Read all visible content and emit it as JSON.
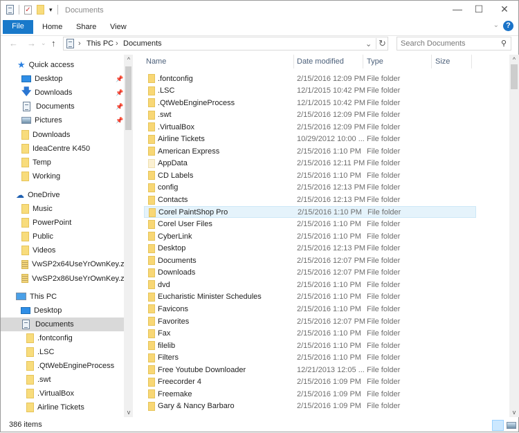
{
  "window": {
    "title": "Documents",
    "minimize": "—",
    "maximize": "☐",
    "close": "✕"
  },
  "ribbon": {
    "file": "File",
    "tabs": [
      "Home",
      "Share",
      "View"
    ],
    "help": "?",
    "collapse": "⌄"
  },
  "address": {
    "back": "←",
    "forward": "→",
    "recent": "⌄",
    "up": "↑",
    "crumbs": [
      "This PC",
      "Documents"
    ],
    "sep": "›",
    "dropdown": "⌄",
    "refresh": "↻"
  },
  "search": {
    "placeholder": "Search Documents",
    "icon": "⚲"
  },
  "nav": {
    "quick_access": "Quick access",
    "quick_items": [
      {
        "label": "Desktop",
        "icon": "desktop-icon",
        "pinned": true
      },
      {
        "label": "Downloads",
        "icon": "downloads-icon",
        "pinned": true
      },
      {
        "label": "Documents",
        "icon": "documents-icon",
        "pinned": true
      },
      {
        "label": "Pictures",
        "icon": "pictures-icon",
        "pinned": true
      },
      {
        "label": "Downloads",
        "icon": "folder-icon"
      },
      {
        "label": "IdeaCentre K450",
        "icon": "folder-icon"
      },
      {
        "label": "Temp",
        "icon": "folder-icon"
      },
      {
        "label": "Working",
        "icon": "folder-icon"
      }
    ],
    "onedrive": "OneDrive",
    "onedrive_items": [
      {
        "label": "Music",
        "icon": "folder-icon"
      },
      {
        "label": "PowerPoint",
        "icon": "folder-icon"
      },
      {
        "label": "Public",
        "icon": "folder-icon"
      },
      {
        "label": "Videos",
        "icon": "folder-icon"
      },
      {
        "label": "VwSP2x64UseYrOwnKey.zip",
        "icon": "zip-icon"
      },
      {
        "label": "VwSP2x86UseYrOwnKey.zip",
        "icon": "zip-icon"
      }
    ],
    "this_pc": "This PC",
    "this_pc_items": [
      {
        "label": "Desktop",
        "icon": "desktop-icon"
      },
      {
        "label": "Documents",
        "icon": "documents-icon",
        "selected": true
      }
    ],
    "documents_children": [
      ".fontconfig",
      ".LSC",
      ".QtWebEngineProcess",
      ".swt",
      ".VirtualBox",
      "Airline Tickets"
    ]
  },
  "columns": {
    "name": "Name",
    "date": "Date modified",
    "type": "Type",
    "size": "Size"
  },
  "files": [
    [
      ".fontconfig",
      "2/15/2016 12:09 PM",
      "File folder"
    ],
    [
      ".LSC",
      "12/1/2015 10:42 PM",
      "File folder"
    ],
    [
      ".QtWebEngineProcess",
      "12/1/2015 10:42 PM",
      "File folder"
    ],
    [
      ".swt",
      "2/15/2016 12:09 PM",
      "File folder"
    ],
    [
      ".VirtualBox",
      "2/15/2016 12:09 PM",
      "File folder"
    ],
    [
      "Airline Tickets",
      "10/29/2012 10:00 ...",
      "File folder"
    ],
    [
      "American Express",
      "2/15/2016 1:10 PM",
      "File folder"
    ],
    [
      "AppData",
      "2/15/2016 12:11 PM",
      "File folder"
    ],
    [
      "CD Labels",
      "2/15/2016 1:10 PM",
      "File folder"
    ],
    [
      "config",
      "2/15/2016 12:13 PM",
      "File folder"
    ],
    [
      "Contacts",
      "2/15/2016 12:13 PM",
      "File folder"
    ],
    [
      "Corel PaintShop Pro",
      "2/15/2016 1:10 PM",
      "File folder"
    ],
    [
      "Corel User Files",
      "2/15/2016 1:10 PM",
      "File folder"
    ],
    [
      "CyberLink",
      "2/15/2016 1:10 PM",
      "File folder"
    ],
    [
      "Desktop",
      "2/15/2016 12:13 PM",
      "File folder"
    ],
    [
      "Documents",
      "2/15/2016 12:07 PM",
      "File folder"
    ],
    [
      "Downloads",
      "2/15/2016 12:07 PM",
      "File folder"
    ],
    [
      "dvd",
      "2/15/2016 1:10 PM",
      "File folder"
    ],
    [
      "Eucharistic Minister Schedules",
      "2/15/2016 1:10 PM",
      "File folder"
    ],
    [
      "Favicons",
      "2/15/2016 1:10 PM",
      "File folder"
    ],
    [
      "Favorites",
      "2/15/2016 12:07 PM",
      "File folder"
    ],
    [
      "Fax",
      "2/15/2016 1:10 PM",
      "File folder"
    ],
    [
      "filelib",
      "2/15/2016 1:10 PM",
      "File folder"
    ],
    [
      "Filters",
      "2/15/2016 1:10 PM",
      "File folder"
    ],
    [
      "Free Youtube Downloader",
      "12/21/2013 12:05 ...",
      "File folder"
    ],
    [
      "Freecorder 4",
      "2/15/2016 1:09 PM",
      "File folder"
    ],
    [
      "Freemake",
      "2/15/2016 1:09 PM",
      "File folder"
    ],
    [
      "Gary & Nancy Barbaro",
      "2/15/2016 1:09 PM",
      "File folder"
    ]
  ],
  "hovered_file": "Corel PaintShop Pro",
  "status": {
    "count": "386 items"
  }
}
